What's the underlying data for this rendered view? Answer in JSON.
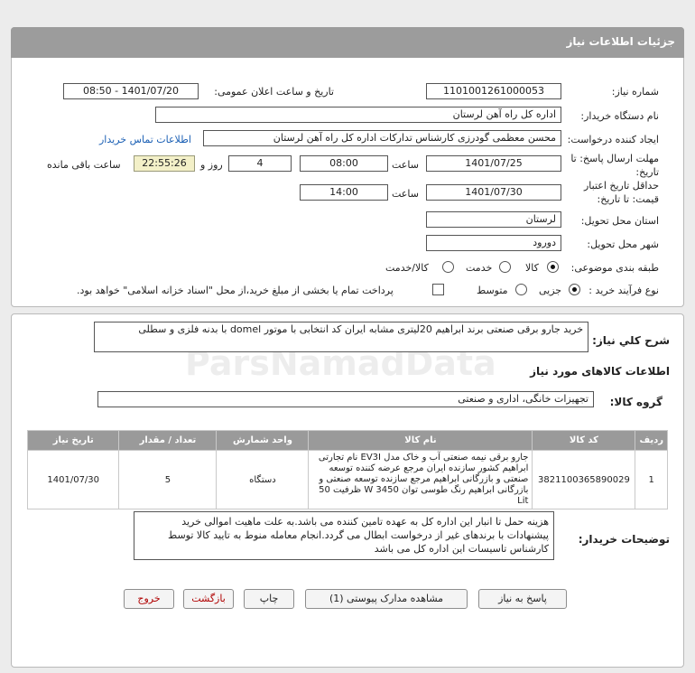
{
  "header": {
    "title": "جزئیات اطلاعات نیاز"
  },
  "form": {
    "need_number_label": "شماره نیاز:",
    "need_number": "1101001261000053",
    "announce_label": "تاریخ و ساعت اعلان عمومی:",
    "announce_value": "1401/07/20 - 08:50",
    "buyer_label": "نام دستگاه خریدار:",
    "buyer_value": "اداره کل راه آهن لرستان",
    "creator_label": "ایجاد کننده درخواست:",
    "creator_value": "محسن معظمی گودرزی کارشناس تداركات اداره كل راه آهن لرستان",
    "contact_link": "اطلاعات تماس خریدار",
    "deadline_label": "مهلت ارسال پاسخ: تا تاریخ:",
    "deadline_date": "1401/07/25",
    "time_label": "ساعت",
    "deadline_time": "08:00",
    "days_value": "4",
    "days_label": "روز و",
    "remaining_time": "22:55:26",
    "remaining_label": "ساعت باقی مانده",
    "validity_label": "حداقل تاریخ اعتبار قیمت: تا تاریخ:",
    "validity_date": "1401/07/30",
    "validity_time": "14:00",
    "province_label": "استان محل تحویل:",
    "province_value": "لرستان",
    "city_label": "شهر محل تحویل:",
    "city_value": "دورود",
    "category_label": "طبقه بندی موضوعی:",
    "category_options": [
      "کالا",
      "خدمت",
      "کالا/خدمت"
    ],
    "category_selected": "کالا",
    "process_label": "نوع فرآیند خرید :",
    "process_options": [
      "جزیی",
      "متوسط"
    ],
    "process_selected": "جزیی",
    "payment_note": "پرداخت تمام یا بخشی از مبلغ خرید،از محل \"اسناد خزانه اسلامی\" خواهد بود."
  },
  "summary": {
    "label": "شرح کلي نياز:",
    "value": "خرید جارو برقی صنعتی برند ابراهیم 20لیتری مشابه ایران کد انتخابی با موتور domel با بدنه فلزی و سطلی"
  },
  "goods": {
    "section_title": "اطلاعات کالاهای مورد نیاز",
    "group_label": "گروه کالا:",
    "group_value": "تجهیزات خانگی، اداری و صنعتی",
    "columns": [
      "ردیف",
      "کد کالا",
      "نام کالا",
      "واحد شمارش",
      "تعداد / مقدار",
      "تاریخ نیاز"
    ],
    "rows": [
      {
        "index": "1",
        "code": "3821100365890029",
        "name": "جارو برقی نیمه صنعتی آب و خاک مدل EV3I نام تجارتی ابراهیم کشور سازنده ایران مرجع عرضه کننده توسعه صنعتی و بازرگانی ابراهیم مرجع سازنده توسعه صنعتی و بازرگانی ابراهیم رنگ طوسی توان 3450 W ظرفیت 50 Lit",
        "unit": "دستگاه",
        "qty": "5",
        "date": "1401/07/30"
      }
    ]
  },
  "buyer_notes": {
    "label": "توضیحات خریدار:",
    "value": "هزینه حمل تا انبار این اداره کل به عهده تامین کننده می باشد.به علت ماهیت اموالی خرید پیشنهادات با برندهای غیر از درخواست ابطال می گردد.انجام معامله منوط به تایید کالا توسط کارشناس تاسیسات این اداره کل می باشد"
  },
  "buttons": {
    "reply": "پاسخ به نیاز",
    "docs": "مشاهده مدارک پیوستی (1)",
    "print": "چاپ",
    "back": "بازگشت",
    "exit": "خروج"
  }
}
